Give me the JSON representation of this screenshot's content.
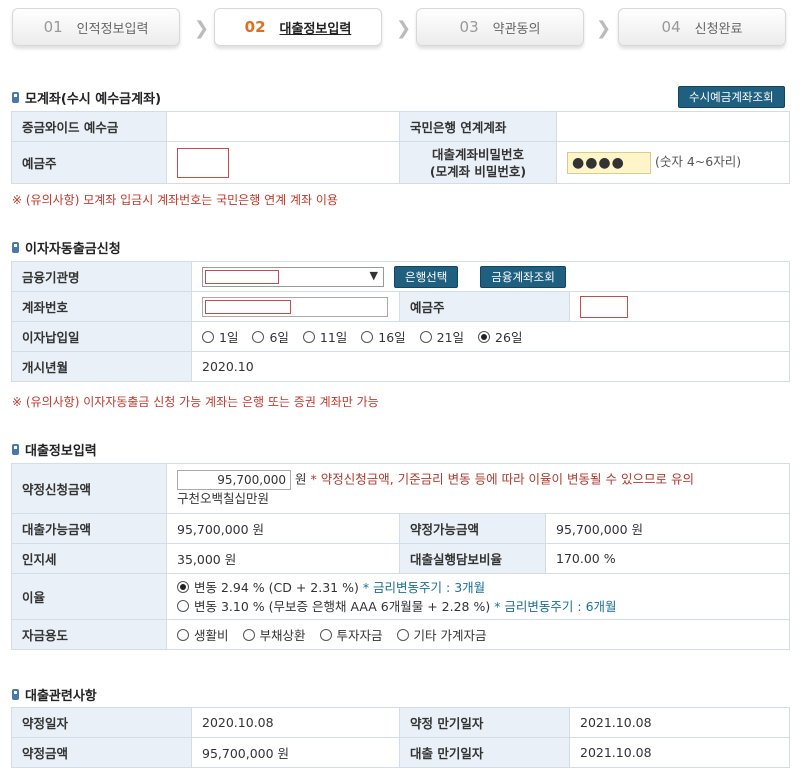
{
  "steps": [
    {
      "num": "01",
      "label": "인적정보입력"
    },
    {
      "num": "02",
      "label": "대출정보입력"
    },
    {
      "num": "03",
      "label": "약관동의"
    },
    {
      "num": "04",
      "label": "신청완료"
    }
  ],
  "mother_account": {
    "title": "모계좌(수시 예수금계좌)",
    "lookup_button": "수시예금계좌조회",
    "row1_label_left": "증금와이드 예수금",
    "row1_label_right": "국민은행 연계계좌",
    "row2_label_left": "예금주",
    "pw_label_line1": "대출계좌비밀번호",
    "pw_label_line2": "(모계좌 비밀번호)",
    "pw_value": "●●●●",
    "pw_hint": "(숫자 4~6자리)",
    "note": "※ (유의사항) 모계좌 입금시 계좌번호는 국민은행 연계 계좌 이용"
  },
  "auto_interest": {
    "title": "이자자동출금신청",
    "bank_label": "금융기관명",
    "bank_select_button": "은행선택",
    "account_lookup_button": "금융계좌조회",
    "account_no_label": "계좌번호",
    "holder_label": "예금주",
    "pay_day_label": "이자납입일",
    "pay_days": [
      "1일",
      "6일",
      "11일",
      "16일",
      "21일",
      "26일"
    ],
    "pay_day_selected": "26일",
    "start_month_label": "개시년월",
    "start_month_value": "2020.10",
    "note": "※ (유의사항) 이자자동출금 신청 가능 계좌는 은행 또는 증권 계좌만 가능"
  },
  "loan_info": {
    "title": "대출정보입력",
    "apply_amount_label": "약정신청금액",
    "apply_amount_value": "95,700,000",
    "apply_amount_unit": "원",
    "apply_amount_note": "* 약정신청금액, 기준금리 변동 등에 따라 이율이 변동될 수 있으므로 유의",
    "apply_amount_korean": "구천오백칠십만원",
    "available_label": "대출가능금액",
    "available_value": "95,700,000 원",
    "contract_available_label": "약정가능금액",
    "contract_available_value": "95,700,000 원",
    "stamp_tax_label": "인지세",
    "stamp_tax_value": "35,000 원",
    "collateral_label": "대출실행담보비율",
    "collateral_value": "170.00 %",
    "rate_label": "이율",
    "rate_option1": "변동 2.94 % (CD + 2.31 %)",
    "rate_option1_note": "* 금리변동주기 : 3개월",
    "rate_option2": "변동 3.10 % (무보증 은행채 AAA 6개월물 + 2.28 %)",
    "rate_option2_note": "* 금리변동주기 : 6개월",
    "purpose_label": "자금용도",
    "purposes": [
      "생활비",
      "부채상환",
      "투자자금",
      "기타 가계자금"
    ]
  },
  "loan_related": {
    "title": "대출관련사항",
    "contract_date_label": "약정일자",
    "contract_date_value": "2020.10.08",
    "contract_maturity_label": "약정 만기일자",
    "contract_maturity_value": "2021.10.08",
    "contract_amount_label": "약정금액",
    "contract_amount_value": "95,700,000 원",
    "loan_maturity_label": "대출 만기일자",
    "loan_maturity_value": "2021.10.08"
  }
}
